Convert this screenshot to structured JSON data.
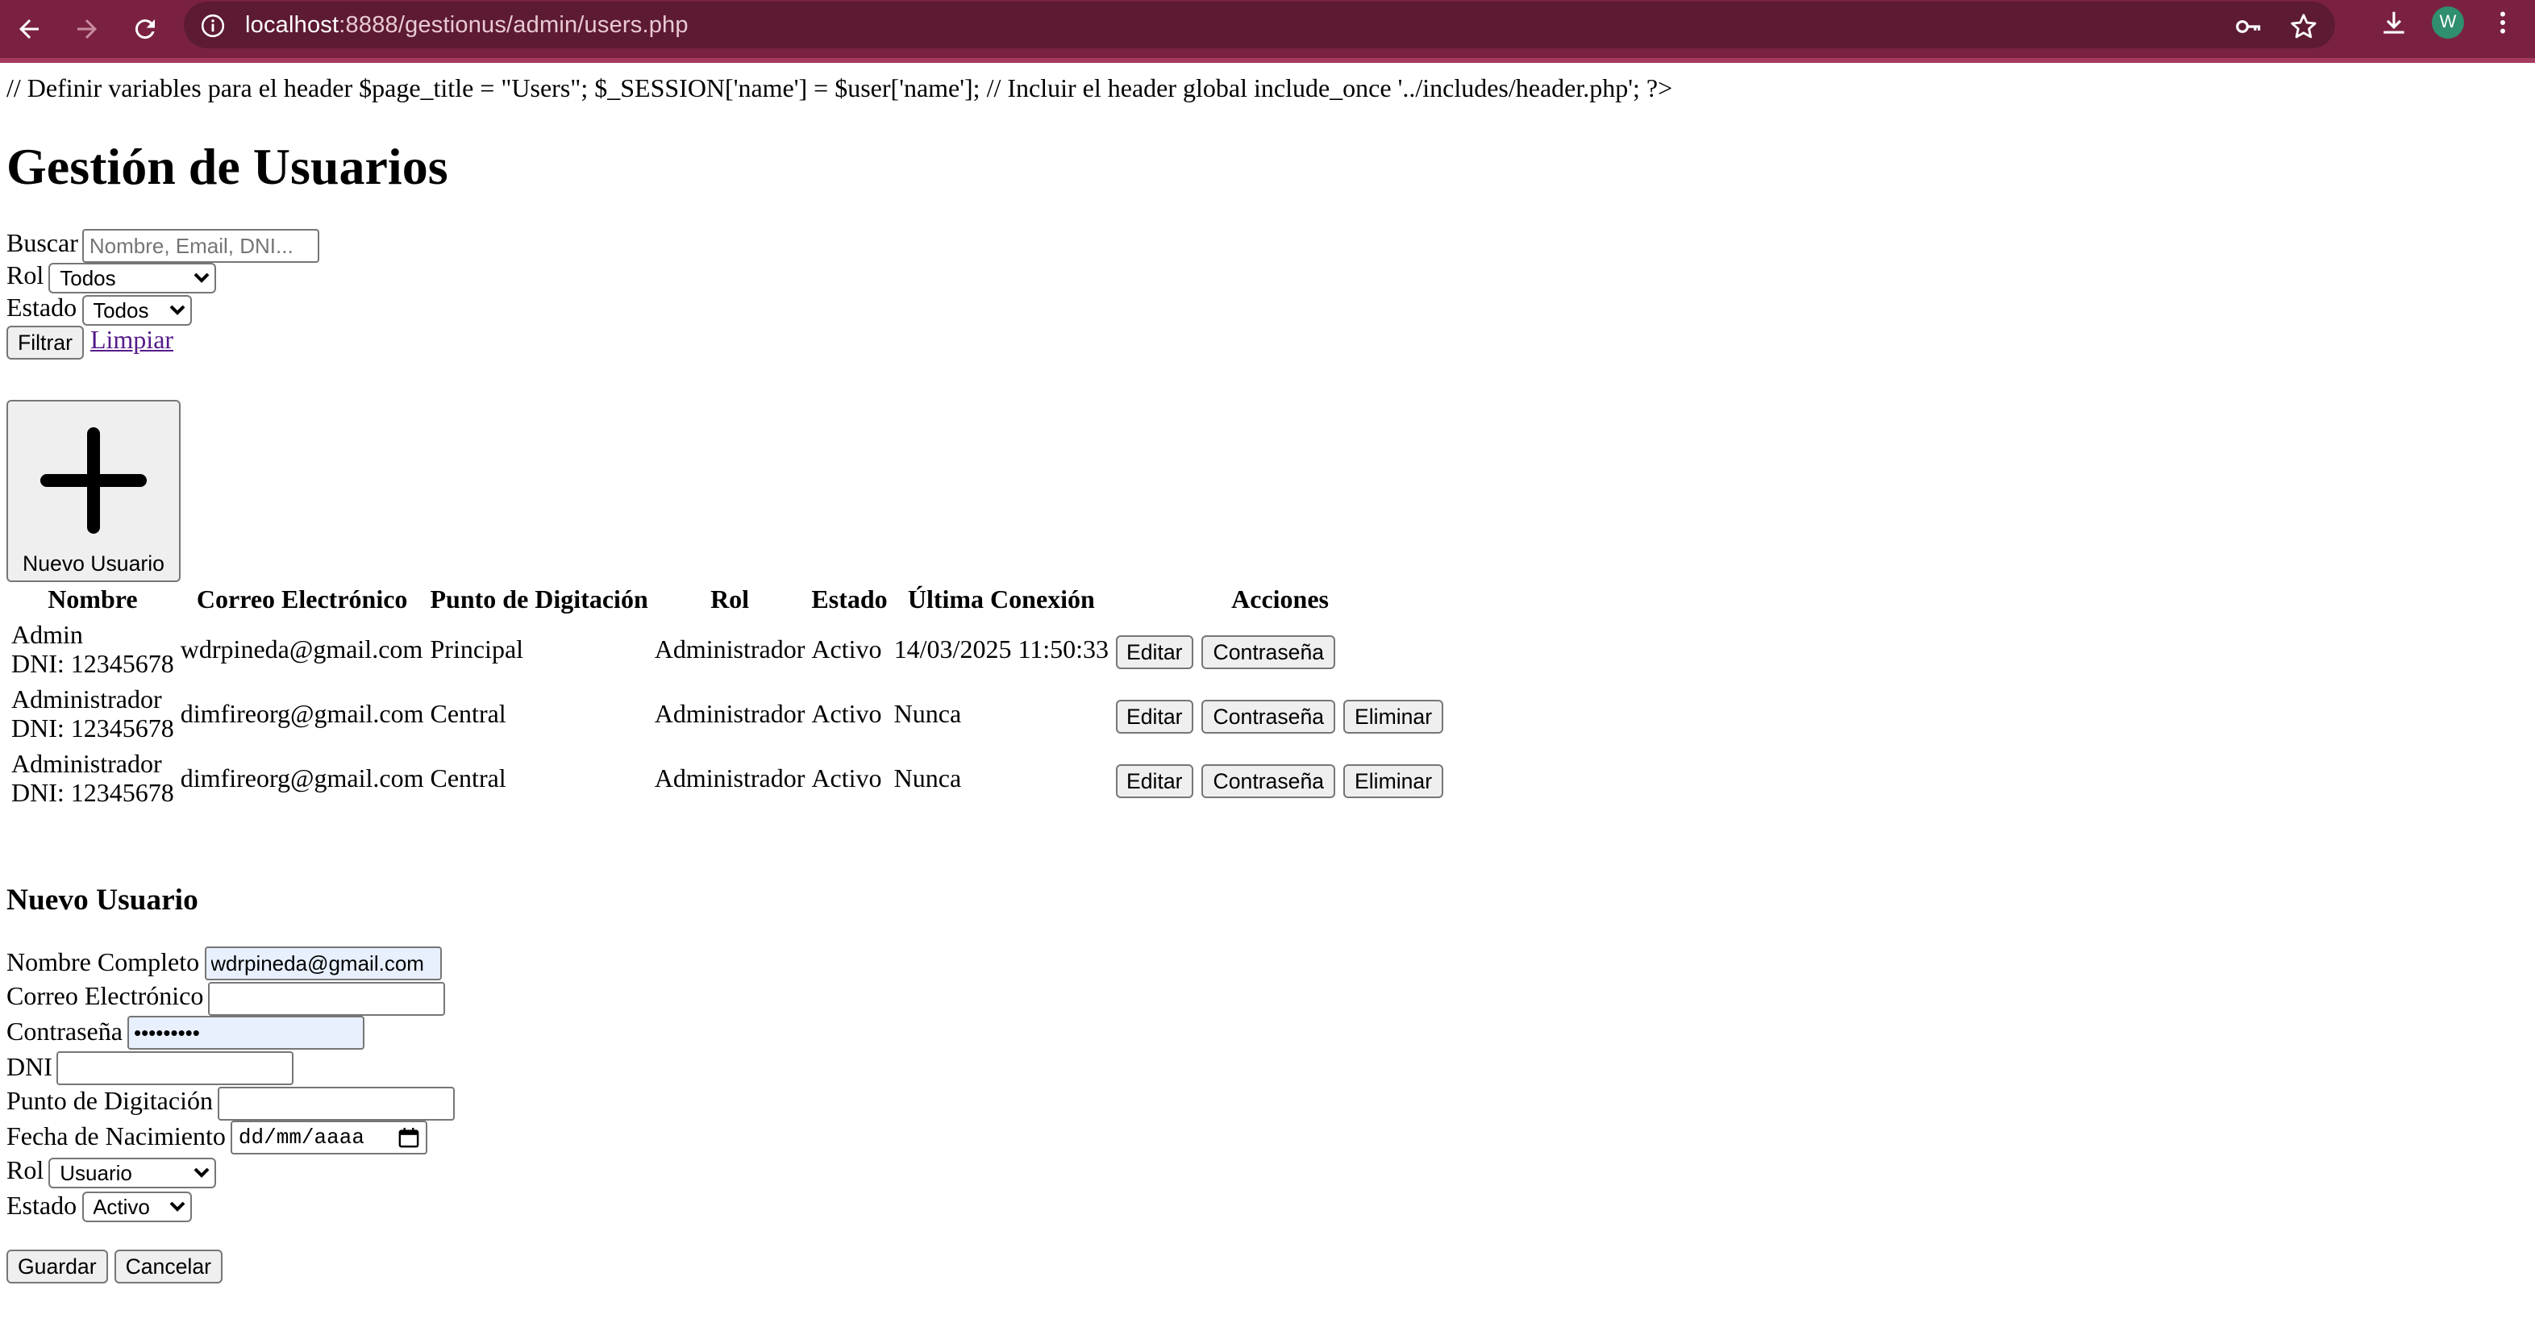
{
  "browser": {
    "url_host": "localhost",
    "url_rest": ":8888/gestionus/admin/users.php",
    "profile_initial": "W",
    "accent": "#7a2141"
  },
  "page": {
    "php_leak": "// Definir variables para el header $page_title = \"Users\"; $_SESSION['name'] = $user['name']; // Incluir el header global include_once '../includes/header.php'; ?>",
    "title": "Gestión de Usuarios"
  },
  "filters": {
    "search_label": "Buscar",
    "search_placeholder": "Nombre, Email, DNI...",
    "role_label": "Rol",
    "role_value": "Todos",
    "status_label": "Estado",
    "status_value": "Todos",
    "filter_button": "Filtrar",
    "clear_link": "Limpiar"
  },
  "new_user_button": "Nuevo Usuario",
  "table": {
    "headers": [
      "Nombre",
      "Correo Electrónico",
      "Punto de Digitación",
      "Rol",
      "Estado",
      "Última Conexión",
      "Acciones"
    ],
    "rows": [
      {
        "name": "Admin",
        "dni": "DNI: 12345678",
        "email": "wdrpineda@gmail.com",
        "point": "Principal",
        "role": "Administrador",
        "status": "Activo",
        "last": "14/03/2025 11:50:33"
      },
      {
        "name": "Administrador",
        "dni": "DNI: 12345678",
        "email": "dimfireorg@gmail.com",
        "point": "Central",
        "role": "Administrador",
        "status": "Activo",
        "last": "Nunca"
      },
      {
        "name": "Administrador",
        "dni": "DNI: 12345678",
        "email": "dimfireorg@gmail.com",
        "point": "Central",
        "role": "Administrador",
        "status": "Activo",
        "last": "Nunca"
      }
    ],
    "edit_label": "Editar",
    "password_label": "Contraseña",
    "delete_label": "Eliminar"
  },
  "form": {
    "title": "Nuevo Usuario",
    "name_label": "Nombre Completo",
    "name_value": "wdrpineda@gmail.com",
    "email_label": "Correo Electrónico",
    "email_value": "",
    "password_label": "Contraseña",
    "password_value": "•••••••••",
    "dni_label": "DNI",
    "dni_value": "",
    "point_label": "Punto de Digitación",
    "point_value": "",
    "birth_label": "Fecha de Nacimiento",
    "birth_placeholder": "dd/mm/aaaa",
    "role_label": "Rol",
    "role_value": "Usuario",
    "status_label": "Estado",
    "status_value": "Activo",
    "save_button": "Guardar",
    "cancel_button": "Cancelar"
  }
}
